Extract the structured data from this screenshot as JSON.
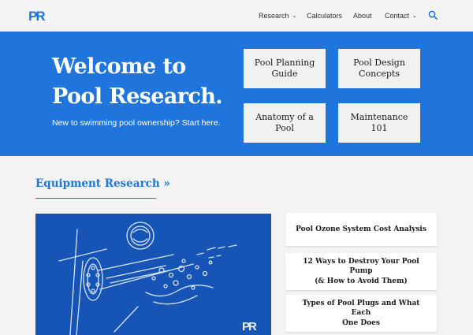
{
  "brand": {
    "logo_text": "PR",
    "color": "#1f75db"
  },
  "nav": {
    "items": [
      {
        "label": "Research",
        "has_dropdown": true
      },
      {
        "label": "Calculators",
        "has_dropdown": false
      },
      {
        "label": "About",
        "has_dropdown": false
      },
      {
        "label": "Contact",
        "has_dropdown": true
      }
    ],
    "dropdown_glyph": "⌄",
    "search_icon": "search-icon"
  },
  "hero": {
    "title_line1": "Welcome to",
    "title_line2": "Pool Research.",
    "subtitle": "New to swimming pool ownership? Start here.",
    "background": "#1f75db",
    "cards": [
      {
        "line1": "Pool Planning",
        "line2": "Guide"
      },
      {
        "line1": "Pool Design",
        "line2": "Concepts"
      },
      {
        "line1": "Anatomy of a",
        "line2": "Pool"
      },
      {
        "line1": "Maintenance",
        "line2": "101"
      }
    ]
  },
  "equipment": {
    "heading": "Equipment Research »",
    "feature_image": {
      "description_icon": "ozone-generator-illustration",
      "watermark": "PR",
      "background": "#1655b6"
    },
    "articles": [
      {
        "line1": "Pool Ozone System Cost Analysis",
        "line2": ""
      },
      {
        "line1": "12 Ways to Destroy Your Pool Pump",
        "line2": "(& How to Avoid Them)"
      },
      {
        "line1": "Types of Pool Plugs and What Each",
        "line2": "One Does"
      }
    ]
  }
}
